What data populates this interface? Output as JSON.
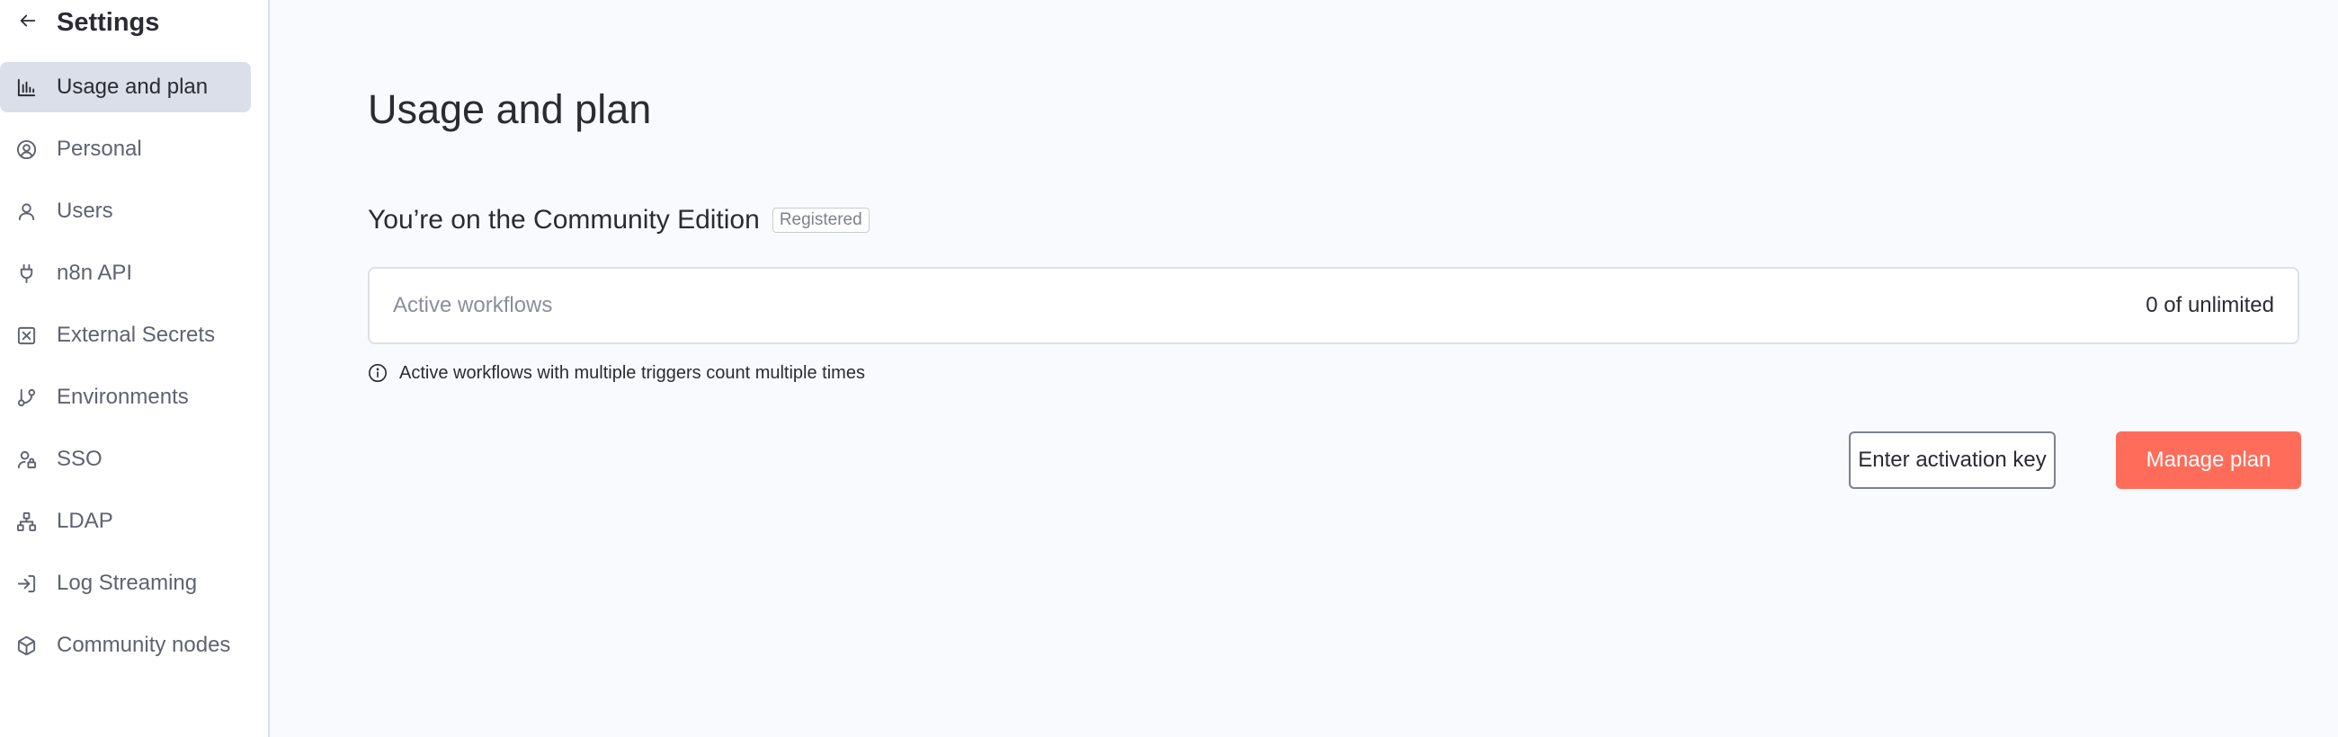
{
  "sidebar": {
    "title": "Settings",
    "back_icon": "arrow-left-icon",
    "items": [
      {
        "label": "Usage and plan",
        "icon": "bar-chart-icon",
        "active": true
      },
      {
        "label": "Personal",
        "icon": "user-circle-icon",
        "active": false
      },
      {
        "label": "Users",
        "icon": "user-icon",
        "active": false
      },
      {
        "label": "n8n API",
        "icon": "plug-icon",
        "active": false
      },
      {
        "label": "External Secrets",
        "icon": "vault-icon",
        "active": false
      },
      {
        "label": "Environments",
        "icon": "git-branch-icon",
        "active": false
      },
      {
        "label": "SSO",
        "icon": "user-lock-icon",
        "active": false
      },
      {
        "label": "LDAP",
        "icon": "network-icon",
        "active": false
      },
      {
        "label": "Log Streaming",
        "icon": "sign-in-icon",
        "active": false
      },
      {
        "label": "Community nodes",
        "icon": "cube-icon",
        "active": false
      }
    ]
  },
  "main": {
    "title": "Usage and plan",
    "edition": {
      "text": "You’re on the Community Edition",
      "badge": "Registered"
    },
    "usage": {
      "label": "Active workflows",
      "value": "0 of unlimited"
    },
    "info": {
      "icon": "info-circle-icon",
      "text": "Active workflows with multiple triggers count multiple times"
    },
    "buttons": {
      "activation_key": "Enter activation key",
      "manage_plan": "Manage plan"
    }
  },
  "colors": {
    "accent": "#ff6d5a",
    "active_nav_bg": "#dadfe9",
    "page_bg": "#f9fafd",
    "text": "#2b2b33",
    "muted_text": "#5f6271"
  }
}
